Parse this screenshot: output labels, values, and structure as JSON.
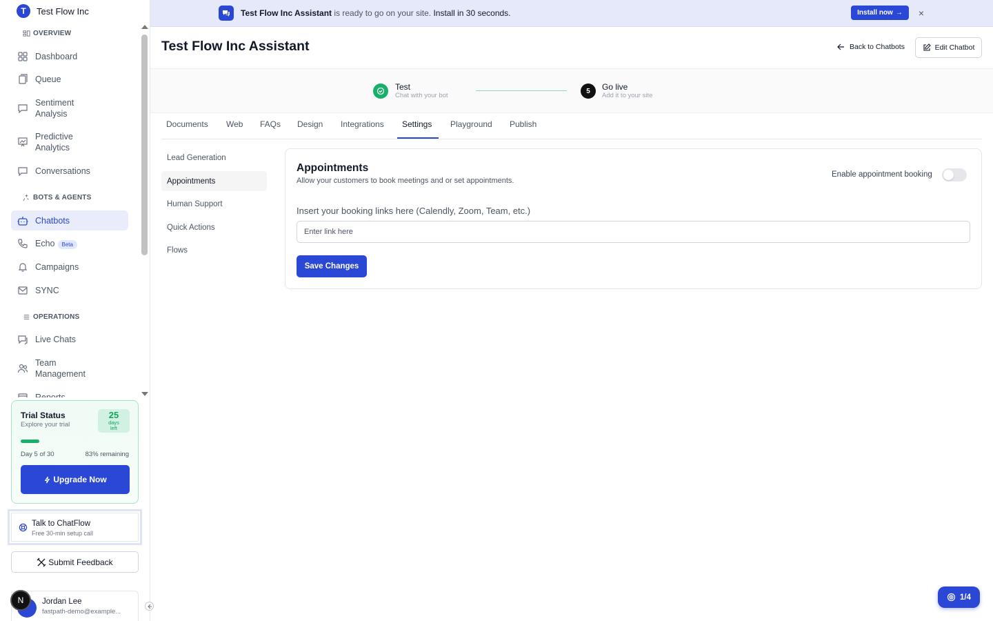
{
  "brand": {
    "initial": "T",
    "name": "Test Flow Inc"
  },
  "sidebar": {
    "sections": {
      "overview": "OVERVIEW",
      "bots": "BOTS & AGENTS",
      "operations": "OPERATIONS"
    },
    "items": {
      "dashboard": "Dashboard",
      "queue": "Queue",
      "sentiment": "Sentiment Analysis",
      "predictive": "Predictive Analytics",
      "conversations": "Conversations",
      "chatbots": "Chatbots",
      "echo": "Echo",
      "echo_badge": "Beta",
      "campaigns": "Campaigns",
      "sync": "SYNC",
      "live_chats": "Live Chats",
      "team": "Team Management",
      "reports": "Reports"
    },
    "active_item": "Chatbots"
  },
  "trial": {
    "title": "Trial Status",
    "subtitle": "Explore your trial",
    "days_left": "25",
    "days_label_1": "days",
    "days_label_2": "left",
    "progress_fraction": 0.17,
    "day_text": "Day 5 of 30",
    "remaining_text": "83% remaining",
    "upgrade_label": "Upgrade Now"
  },
  "talk": {
    "title": "Talk to ChatFlow",
    "subtitle": "Free 30-min setup call"
  },
  "feedback_label": "Submit Feedback",
  "user": {
    "name": "Jordan Lee",
    "email": "fastpath-demo@example...",
    "badge": "N"
  },
  "banner": {
    "name": "Test Flow Inc Assistant",
    "middle": " is ready to go on your site. ",
    "cta": "Install in 30 seconds.",
    "button": "Install now",
    "close": "×"
  },
  "header": {
    "title": "Test Flow Inc Assistant",
    "back_label": "Back to Chatbots",
    "edit_label": "Edit Chatbot"
  },
  "steps": [
    {
      "title": "Test",
      "subtitle": "Chat with your bot",
      "state": "done"
    },
    {
      "number": "5",
      "title": "Go live",
      "subtitle": "Add it to your site",
      "state": "current"
    }
  ],
  "tabs": [
    "Documents",
    "Web",
    "FAQs",
    "Design",
    "Integrations",
    "Settings",
    "Playground",
    "Publish"
  ],
  "active_tab": "Settings",
  "settings_nav": [
    "Lead Generation",
    "Appointments",
    "Human Support",
    "Quick Actions",
    "Flows"
  ],
  "active_settings_item": "Appointments",
  "appointments": {
    "title": "Appointments",
    "subtitle": "Allow your customers to book meetings and or set appointments.",
    "toggle_label": "Enable appointment booking",
    "toggle_on": false,
    "field_label": "Insert your booking links here (Calendly, Zoom, Team, etc.)",
    "input_value": "",
    "input_placeholder": "Enter link here",
    "save_label": "Save Changes"
  },
  "tour": {
    "label": "1/4"
  },
  "colors": {
    "accent": "#2b47d6",
    "success": "#16b06a",
    "banner_bg": "#e6e9f9"
  }
}
